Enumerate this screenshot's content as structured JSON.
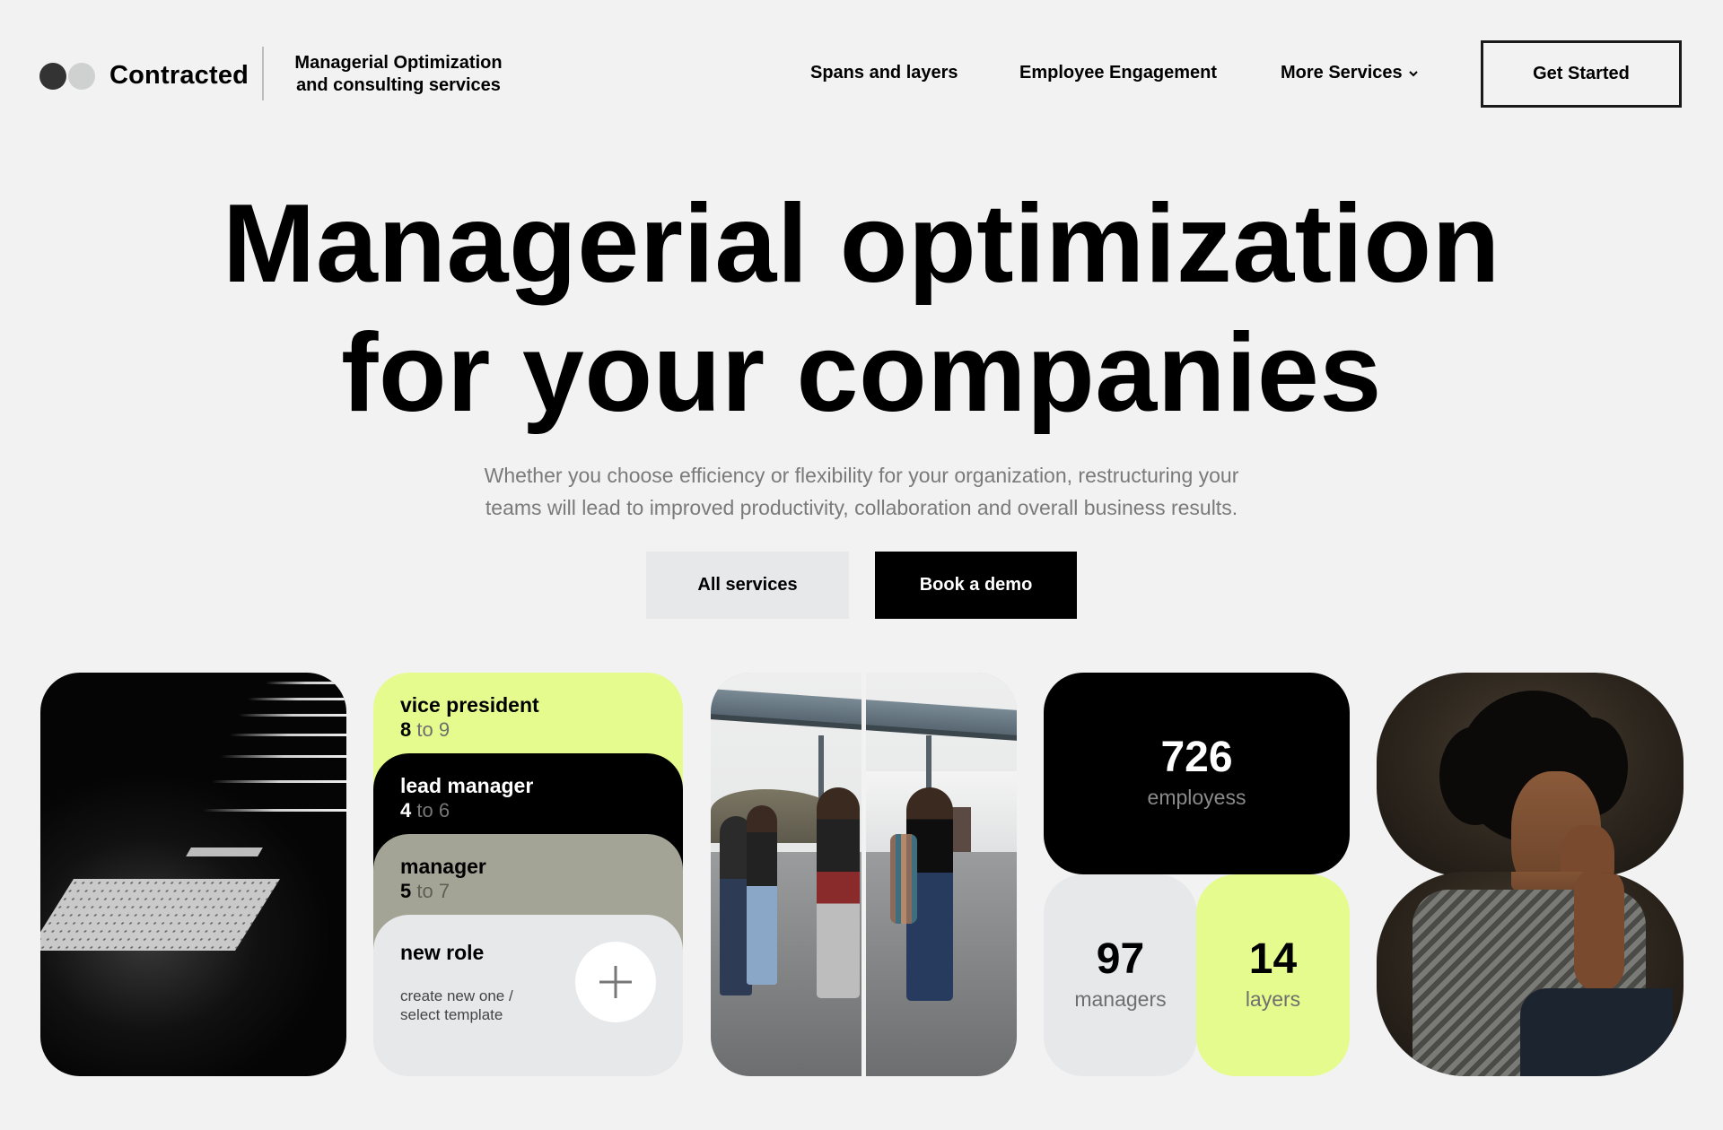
{
  "header": {
    "brand": "Contracted",
    "tagline_line1": "Managerial Optimization",
    "tagline_line2": "and consulting services",
    "nav": {
      "spans": "Spans and layers",
      "engagement": "Employee Engagement",
      "more": "More Services"
    },
    "cta": "Get Started"
  },
  "hero": {
    "title_line1": "Managerial optimization",
    "title_line2": "for your companies",
    "subtitle_line1": "Whether you choose efficiency or flexibility for your organization, restructuring your",
    "subtitle_line2": "teams will lead to improved productivity, collaboration and overall business results.",
    "btn_all": "All services",
    "btn_demo": "Book a demo"
  },
  "roles": {
    "vp": {
      "title": "vice president",
      "from": "8",
      "rest": " to 9"
    },
    "lead": {
      "title": "lead manager",
      "from": "4",
      "rest": " to 6"
    },
    "manager": {
      "title": "manager",
      "from": "5",
      "rest": " to 7"
    },
    "new_role": {
      "title": "new role",
      "hint_line1": "create new one /",
      "hint_line2": "select template"
    }
  },
  "stats": {
    "employees": {
      "value": "726",
      "label": "employess"
    },
    "managers": {
      "value": "97",
      "label": "managers"
    },
    "layers": {
      "value": "14",
      "label": "layers"
    }
  },
  "colors": {
    "background": "#f2f2f2",
    "accent_lime": "#e5fb8e",
    "olive": "#a4a496",
    "light_gray": "#e7e8ea",
    "black": "#000000"
  }
}
